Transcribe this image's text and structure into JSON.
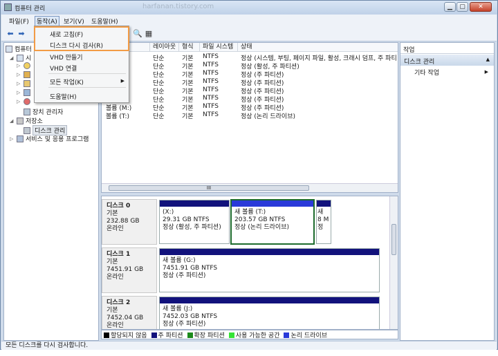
{
  "window": {
    "title": "컴퓨터 관리",
    "bg_url_fragment": "harfanan.tistory.com",
    "min_label": "▁",
    "max_label": "▢",
    "close_label": "✕"
  },
  "menubar": {
    "file": "파일(F)",
    "action": "동작(A)",
    "view": "보기(V)",
    "help": "도움말(H)"
  },
  "action_menu": {
    "refresh": "새로 고침(F)",
    "rescan": "디스크 다시 검사(R)",
    "create_vhd": "VHD 만들기",
    "attach_vhd": "VHD 연결",
    "all_tasks": "모든 작업(K)",
    "help": "도움말(H)"
  },
  "tree": {
    "root": "컴퓨터 관리",
    "system": "시",
    "device_manager": "장치 관리자",
    "storage": "저장소",
    "disk_management": "디스크 관리",
    "services": "서비스 및 응용 프로그램"
  },
  "volume_list": {
    "headers": [
      "레이아웃",
      "형식",
      "파일 시스템",
      "상태"
    ],
    "rows": [
      {
        "name": "",
        "layout": "단순",
        "type": "기본",
        "fs": "NTFS",
        "status": "정상 (시스템, 부팅, 페이지 파일, 활성, 크래시 덤프, 주 파티"
      },
      {
        "name": "",
        "layout": "단순",
        "type": "기본",
        "fs": "NTFS",
        "status": "정상 (활성, 주 파티션)"
      },
      {
        "name": "",
        "layout": "단순",
        "type": "기본",
        "fs": "NTFS",
        "status": "정상 (주 파티션)"
      },
      {
        "name": "(G:)",
        "layout": "단순",
        "type": "기본",
        "fs": "NTFS",
        "status": "정상 (주 파티션)"
      },
      {
        "name": "(J:)",
        "layout": "단순",
        "type": "기본",
        "fs": "NTFS",
        "status": "정상 (주 파티션)"
      },
      {
        "name": "(L:)",
        "layout": "단순",
        "type": "기본",
        "fs": "NTFS",
        "status": "정상 (주 파티션)"
      },
      {
        "name": "볼륨 (M:)",
        "layout": "단순",
        "type": "기본",
        "fs": "NTFS",
        "status": "정상 (주 파티션)"
      },
      {
        "name": "볼륨 (T:)",
        "layout": "단순",
        "type": "기본",
        "fs": "NTFS",
        "status": "정상 (논리 드라이브)"
      }
    ],
    "scroll_thumb": "III"
  },
  "disks": [
    {
      "name": "디스크 0",
      "kind": "기본",
      "size": "232.88 GB",
      "state": "온라인",
      "partitions": [
        {
          "title": "(X:)",
          "size": "29.31 GB NTFS",
          "status": "정상 (활성, 주 파티션)"
        },
        {
          "title": "새 볼륨  (T:)",
          "size": "203.57 GB NTFS",
          "status": "정상 (논리 드라이브)"
        },
        {
          "title": "새",
          "size": "8 M",
          "status": "정"
        }
      ]
    },
    {
      "name": "디스크 1",
      "kind": "기본",
      "size": "7451.91 GB",
      "state": "온라인",
      "partitions": [
        {
          "title": "새 볼륨  (G:)",
          "size": "7451.91 GB NTFS",
          "status": "정상 (주 파티션)"
        }
      ]
    },
    {
      "name": "디스크 2",
      "kind": "기본",
      "size": "7452.04 GB",
      "state": "온라인",
      "partitions": [
        {
          "title": "새 볼륨  (J:)",
          "size": "7452.03 GB NTFS",
          "status": "정상 (주 파티션)"
        }
      ]
    }
  ],
  "legend": {
    "unallocated": "할당되지 않음",
    "primary": "주 파티션",
    "extended": "확장 파티션",
    "free": "사용 가능한 공간",
    "logical": "논리 드라이브"
  },
  "actions_pane": {
    "header": "작업",
    "section": "디스크 관리",
    "section_arrow": "▲",
    "more": "기타 작업",
    "more_arrow": "▶"
  },
  "statusbar": {
    "text": "모든 디스크를 다시 검사합니다."
  },
  "colors": {
    "unallocated": "#000000",
    "primary": "#12127c",
    "extended": "#1c8a1c",
    "free": "#35e335",
    "logical": "#2a3ad9"
  }
}
